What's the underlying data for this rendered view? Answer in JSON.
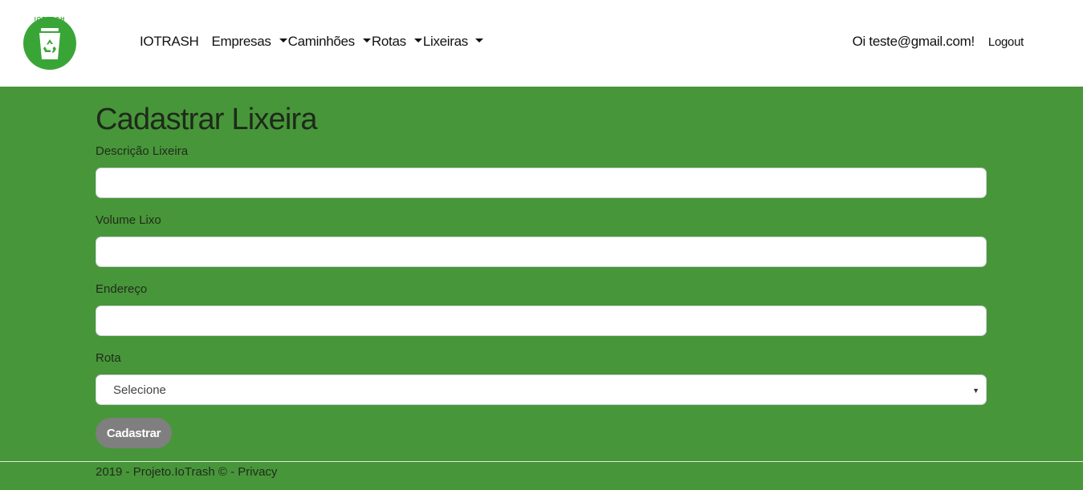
{
  "nav": {
    "brand": "IOTRASH",
    "items": [
      {
        "label": "Empresas"
      },
      {
        "label": "Caminhões"
      },
      {
        "label": "Rotas"
      },
      {
        "label": "Lixeiras"
      }
    ],
    "greeting": "Oi teste@gmail.com!",
    "logout": "Logout"
  },
  "logo": {
    "text": "IOTRASH",
    "icon": "recycle-bin-icon",
    "color": "#3aa537"
  },
  "page": {
    "title": "Cadastrar Lixeira"
  },
  "form": {
    "descricao_label": "Descrição Lixeira",
    "descricao_value": "",
    "volume_label": "Volume Lixo",
    "volume_value": "",
    "endereco_label": "Endereço",
    "endereco_value": "",
    "rota_label": "Rota",
    "rota_selected": "Selecione",
    "submit_label": "Cadastrar"
  },
  "footer": {
    "text": "2019 - Projeto.IoTrash © - ",
    "privacy_link": "Privacy"
  },
  "colors": {
    "background": "#48963a",
    "header": "#ffffff",
    "button": "#7e7f7e"
  }
}
